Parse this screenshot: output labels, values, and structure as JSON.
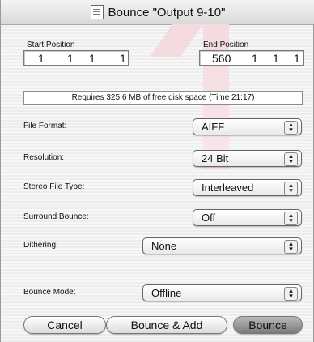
{
  "dialog": {
    "title": "Bounce \"Output 9-10\""
  },
  "positions": {
    "start_label": "Start Position",
    "start_values": [
      "1",
      "1",
      "1",
      "1"
    ],
    "end_label": "End Position",
    "end_values": [
      "560",
      "1",
      "1",
      "1"
    ]
  },
  "disk": {
    "requirement": "Requires 325,6 MB of free disk space  (Time 21:17)"
  },
  "options": {
    "file_format": {
      "label": "File Format:",
      "value": "AIFF"
    },
    "resolution": {
      "label": "Resolution:",
      "value": "24 Bit"
    },
    "stereo_file_type": {
      "label": "Stereo File Type:",
      "value": "Interleaved"
    },
    "surround_bounce": {
      "label": "Surround Bounce:",
      "value": "Off"
    },
    "dithering": {
      "label": "Dithering:",
      "value": "None"
    },
    "bounce_mode": {
      "label": "Bounce Mode:",
      "value": "Offline"
    }
  },
  "buttons": {
    "cancel": "Cancel",
    "bounce_add": "Bounce & Add",
    "bounce": "Bounce"
  },
  "icons": {
    "document": "document-icon",
    "popup": "up-down-arrows-icon"
  }
}
